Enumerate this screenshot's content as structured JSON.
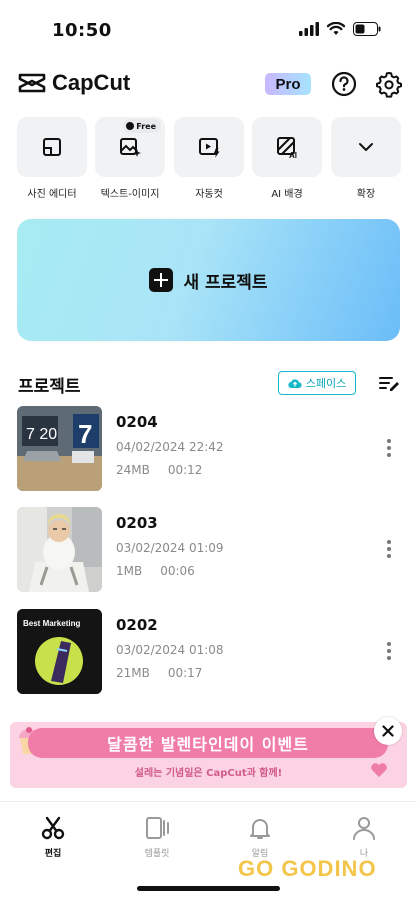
{
  "status": {
    "time": "10:50"
  },
  "header": {
    "app_name": "CapCut",
    "pro_badge": "Pro",
    "help_icon": "question-circle-icon",
    "settings_icon": "gear-icon"
  },
  "tools": [
    {
      "label": "사진 에디터",
      "icon": "photo-frame-icon"
    },
    {
      "label": "텍스트-이미지",
      "icon": "image-sparkle-icon",
      "badge": "Free"
    },
    {
      "label": "자동컷",
      "icon": "auto-cut-icon"
    },
    {
      "label": "AI 배경",
      "icon": "ai-background-icon"
    },
    {
      "label": "확장",
      "icon": "chevron-down-icon"
    }
  ],
  "new_project": {
    "label": "새 프로젝트"
  },
  "projects_section": {
    "title": "프로젝트",
    "space_button": "스페이스"
  },
  "projects": [
    {
      "name": "0204",
      "date": "04/02/2024 22:42",
      "size": "24MB",
      "duration": "00:12"
    },
    {
      "name": "0203",
      "date": "03/02/2024 01:09",
      "size": "1MB",
      "duration": "00:06"
    },
    {
      "name": "0202",
      "date": "03/02/2024 01:08",
      "size": "21MB",
      "duration": "00:17",
      "thumb_text": "Best Marketing"
    }
  ],
  "banner": {
    "title": "달콤한 발렌타인데이 이벤트",
    "subtitle": "설레는 기념일은 CapCut과 함께!"
  },
  "tabs": [
    {
      "label": "편집",
      "icon": "scissors-icon",
      "active": true
    },
    {
      "label": "템플릿",
      "icon": "template-icon",
      "active": false
    },
    {
      "label": "알림",
      "icon": "bell-icon",
      "active": false
    },
    {
      "label": "나",
      "icon": "profile-icon",
      "active": false
    }
  ],
  "watermark": "GO GODINO",
  "colors": {
    "accent": "#14b8c8",
    "card_bg": "#f1f2f4",
    "gradient_start": "#a8ecf2",
    "gradient_end": "#6bbdf8",
    "banner_pink": "#f07ca8"
  }
}
